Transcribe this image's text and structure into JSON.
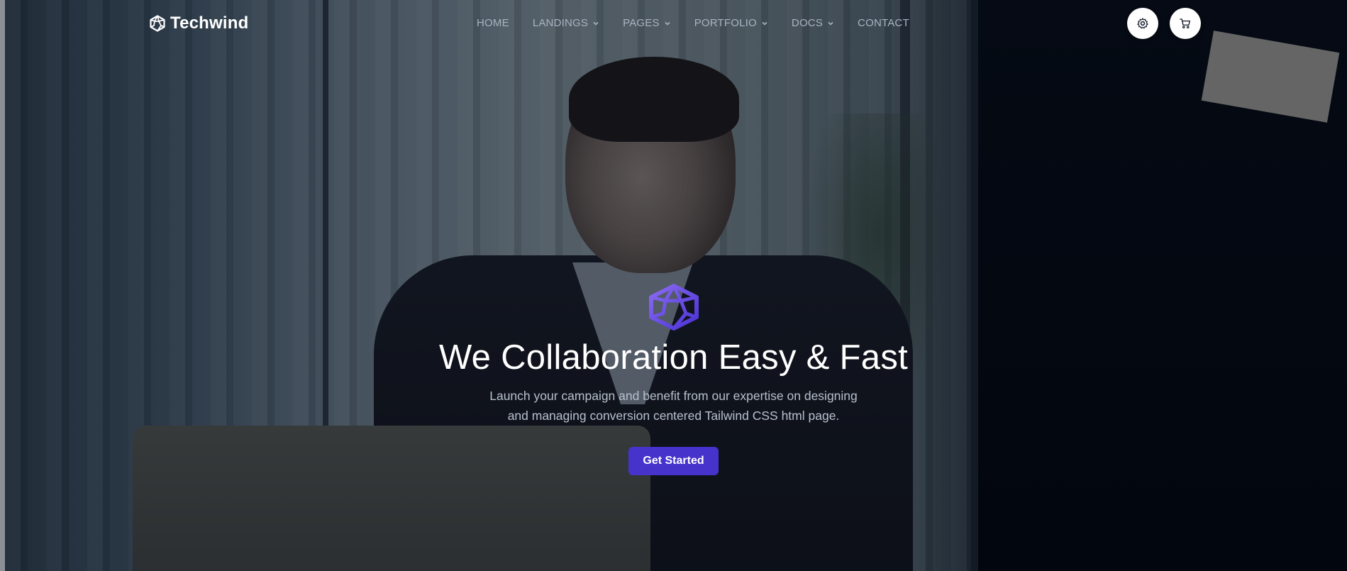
{
  "brand": {
    "name": "Techwind",
    "logo_icon": "hexagon-cube-logo-icon"
  },
  "nav": {
    "items": [
      {
        "label": "HOME",
        "has_dropdown": false
      },
      {
        "label": "LANDINGS",
        "has_dropdown": true
      },
      {
        "label": "PAGES",
        "has_dropdown": true
      },
      {
        "label": "PORTFOLIO",
        "has_dropdown": true
      },
      {
        "label": "DOCS",
        "has_dropdown": true
      },
      {
        "label": "CONTACT",
        "has_dropdown": false
      }
    ],
    "dropdown_icon": "chevron-down-icon"
  },
  "actions": {
    "settings_icon": "gear-icon",
    "cart_icon": "shopping-cart-icon"
  },
  "hero": {
    "title": "We Collaboration Easy & Fast",
    "subtitle_line1": "Launch your campaign and benefit from our expertise on designing",
    "subtitle_line2": "and managing conversion centered Tailwind CSS html page.",
    "cta_label": "Get Started"
  },
  "colors": {
    "accent": "#4533cc",
    "logo_gradient_start": "#7b5cf0",
    "logo_gradient_end": "#4a32d4",
    "nav_text": "#a9b3c1",
    "title_text": "#ffffff"
  }
}
